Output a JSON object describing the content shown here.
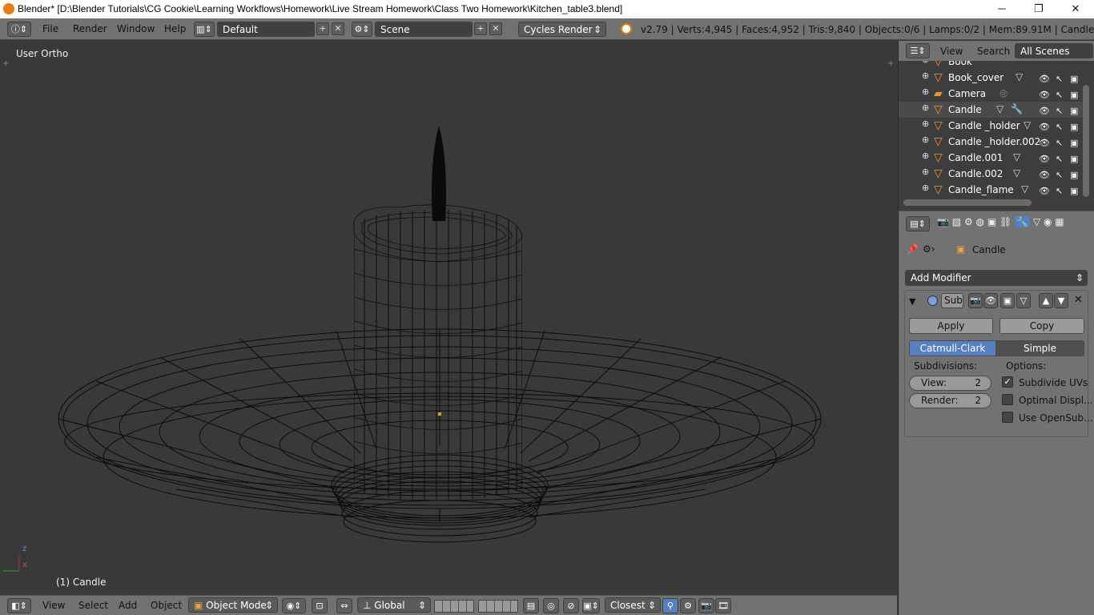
{
  "window": {
    "title": "Blender* [D:\\Blender Tutorials\\CG Cookie\\Learning Workflows\\Homework\\Live Stream Homework\\Class Two Homework\\Kitchen_table3.blend]",
    "minimize": "─",
    "maximize": "❐",
    "close": "✕"
  },
  "info_header": {
    "menus": [
      "File",
      "Render",
      "Window",
      "Help"
    ],
    "screen_layout": "Default",
    "scene": "Scene",
    "render_engine": "Cycles Render",
    "stats": "v2.79 | Verts:4,945 | Faces:4,952 | Tris:9,840 | Objects:0/6 | Lamps:0/2 | Mem:89.91M | Candle"
  },
  "viewport": {
    "view_label": "User Ortho",
    "object_label": "(1) Candle",
    "axis_x": "x",
    "axis_z": "z"
  },
  "bottom_header": {
    "menus": [
      "View",
      "Select",
      "Add",
      "Object"
    ],
    "mode": "Object Mode",
    "orientation": "Global",
    "snap_target": "Closest"
  },
  "outliner": {
    "view_menu": "View",
    "search_menu": "Search",
    "scenes_dropdown": "All Scenes",
    "items": [
      {
        "name": "Book"
      },
      {
        "name": "Book_cover"
      },
      {
        "name": "Camera"
      },
      {
        "name": "Candle"
      },
      {
        "name": "Candle _holder"
      },
      {
        "name": "Candle _holder.002"
      },
      {
        "name": "Candle.001"
      },
      {
        "name": "Candle.002"
      },
      {
        "name": "Candle_flame"
      }
    ]
  },
  "properties": {
    "context_object": "Candle",
    "add_modifier": "Add Modifier",
    "modifier_name": "Sub",
    "apply": "Apply",
    "copy": "Copy",
    "catmull_clark": "Catmull-Clark",
    "simple": "Simple",
    "subdivisions_label": "Subdivisions:",
    "options_label": "Options:",
    "view_field": "View:",
    "view_value": "2",
    "render_field": "Render:",
    "render_value": "2",
    "subdivide_uvs": "Subdivide UVs",
    "optimal_display": "Optimal Displ...",
    "use_opensubdiv": "Use OpenSub..."
  },
  "colors": {
    "header_gray": "#727272",
    "viewport_bg": "#393939",
    "outliner_bg": "#3d3d3d",
    "accent_blue": "#5680c2",
    "object_orange": "#f0922a"
  }
}
